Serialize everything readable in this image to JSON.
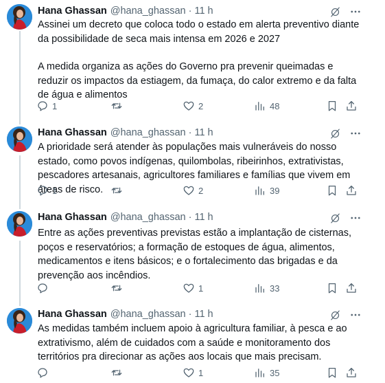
{
  "tweets": [
    {
      "name": "Hana Ghassan",
      "handle": "@hana_ghassan",
      "time": "11 h",
      "paragraphs": [
        "Assinei um decreto que coloca todo o estado em alerta preventivo diante da possibilidade de seca mais intensa em 2026 e 2027",
        "A medida organiza as ações do Governo pra prevenir queimadas e reduzir os impactos da estiagem, da fumaça, do calor extremo e da falta de água e alimentos"
      ],
      "replies": "1",
      "reposts": "",
      "likes": "2",
      "views": "48"
    },
    {
      "name": "Hana Ghassan",
      "handle": "@hana_ghassan",
      "time": "11 h",
      "paragraphs": [
        "A prioridade será atender às populações mais vulneráveis do nosso estado, como povos indígenas, quilombolas, ribeirinhos, extrativistas, pescadores artesanais, agricultores familiares e famílias que vivem em áreas de risco."
      ],
      "replies": "1",
      "reposts": "",
      "likes": "2",
      "views": "39"
    },
    {
      "name": "Hana Ghassan",
      "handle": "@hana_ghassan",
      "time": "11 h",
      "paragraphs": [
        "Entre as ações preventivas previstas estão a implantação de cisternas, poços e reservatórios; a formação de estoques de água, alimentos, medicamentos e itens básicos; e o fortalecimento das brigadas e da prevenção aos incêndios."
      ],
      "replies": "",
      "reposts": "",
      "likes": "1",
      "views": "33"
    },
    {
      "name": "Hana Ghassan",
      "handle": "@hana_ghassan",
      "time": "11 h",
      "paragraphs": [
        "As medidas também incluem apoio à agricultura familiar, à pesca e ao extrativismo, além de cuidados com a saúde e monitoramento dos territórios pra direcionar as ações aos locais que mais precisam."
      ],
      "replies": "",
      "reposts": "",
      "likes": "1",
      "views": "35"
    }
  ],
  "icons": {
    "reply": "comment-icon",
    "repost": "repost-icon",
    "like": "heart-icon",
    "views": "views-icon",
    "bookmark": "bookmark-icon",
    "share": "share-icon",
    "grok": "grok-icon",
    "more": "more-icon"
  },
  "colors": {
    "text": "#0f1419",
    "muted": "#536471",
    "thread_line": "#cfd9de",
    "avatar_bg": "#1d7fd0"
  }
}
